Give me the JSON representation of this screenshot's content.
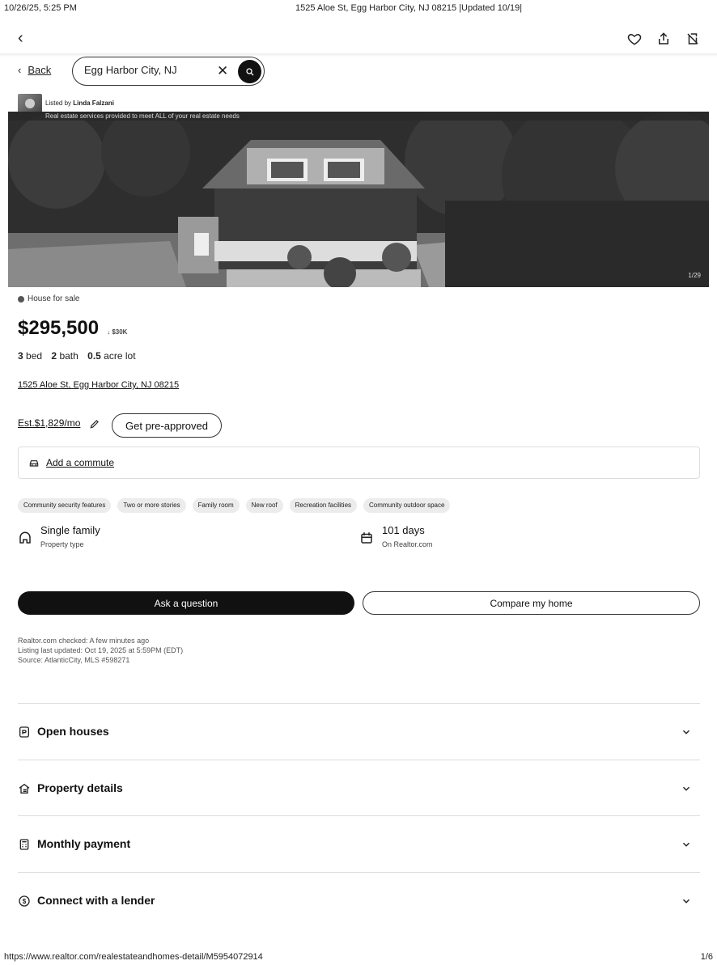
{
  "print_header": {
    "datetime": "10/26/25, 5:25 PM",
    "page_title": "1525 Aloe St, Egg Harbor City, NJ 08215 |Updated 10/19|"
  },
  "topbar": {
    "icons": [
      "chevron-left-icon",
      "heart-icon",
      "share-icon",
      "hide-icon"
    ]
  },
  "search": {
    "back_label": "Back",
    "value": "Egg Harbor City, NJ"
  },
  "listing_agent": {
    "prefix": "Listed by ",
    "name": "Linda Falzani",
    "banner": "Real estate services provided to meet ALL of your real estate needs"
  },
  "photo": {
    "counter": "1/29"
  },
  "listing": {
    "status": "House for sale",
    "price": "$295,500",
    "price_change": "↓ $30K",
    "beds": "3",
    "beds_label": "bed",
    "baths": "2",
    "baths_label": "bath",
    "lot": "0.5",
    "lot_label": "acre lot",
    "address": "1525 Aloe St, Egg Harbor City, NJ 08215",
    "estimate": "Est.$1,829/mo",
    "preapproved_label": "Get pre-approved",
    "commute_label": "Add a commute"
  },
  "tags": [
    "Community security features",
    "Two or more stories",
    "Family room",
    "New roof",
    "Recreation facilities",
    "Community outdoor space"
  ],
  "highlights": {
    "property_type_value": "Single family",
    "property_type_label": "Property type",
    "days_value": "101 days",
    "days_label": "On Realtor.com"
  },
  "actions": {
    "ask_label": "Ask a question",
    "compare_label": "Compare my home"
  },
  "meta": {
    "checked": "Realtor.com checked: A few minutes ago",
    "updated": "Listing last updated: Oct 19, 2025 at 5:59PM (EDT)",
    "source": "Source: AtlanticCity, MLS #598271"
  },
  "sections": [
    {
      "label": "Open houses",
      "icon": "open-house-icon"
    },
    {
      "label": "Property details",
      "icon": "house-details-icon"
    },
    {
      "label": "Monthly payment",
      "icon": "calculator-icon"
    },
    {
      "label": "Connect with a lender",
      "icon": "dollar-circle-icon"
    }
  ],
  "print_footer": {
    "url": "https://www.realtor.com/realestateandhomes-detail/M5954072914",
    "page": "1/6"
  }
}
